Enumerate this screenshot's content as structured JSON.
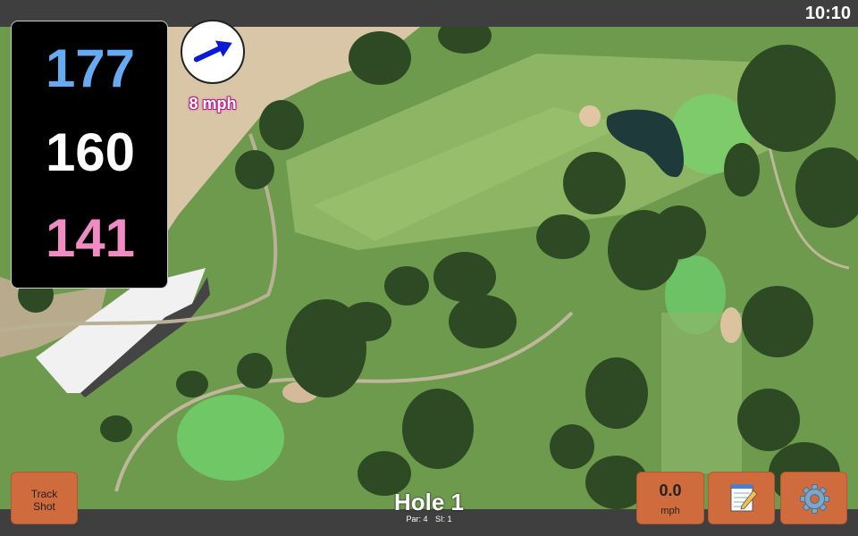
{
  "status": {
    "time": "10:10"
  },
  "distances": {
    "back": "177",
    "middle": "160",
    "front": "141",
    "back_color": "#66aaf2",
    "middle_color": "#ffffff",
    "front_color": "#f08bc3"
  },
  "wind": {
    "icon": "wind-arrow-icon",
    "speed": "8 mph",
    "arrow_color": "#0a1ad6"
  },
  "buttons": {
    "track_shot_line1": "Track",
    "track_shot_line2": "Shot",
    "speed_value": "0.0",
    "speed_unit": "mph",
    "notes_icon": "notepad-icon",
    "settings_icon": "gear-icon",
    "button_color": "#cf6b3c"
  },
  "hole": {
    "title": "Hole 1",
    "par": "Par: 4",
    "si": "SI: 1"
  }
}
